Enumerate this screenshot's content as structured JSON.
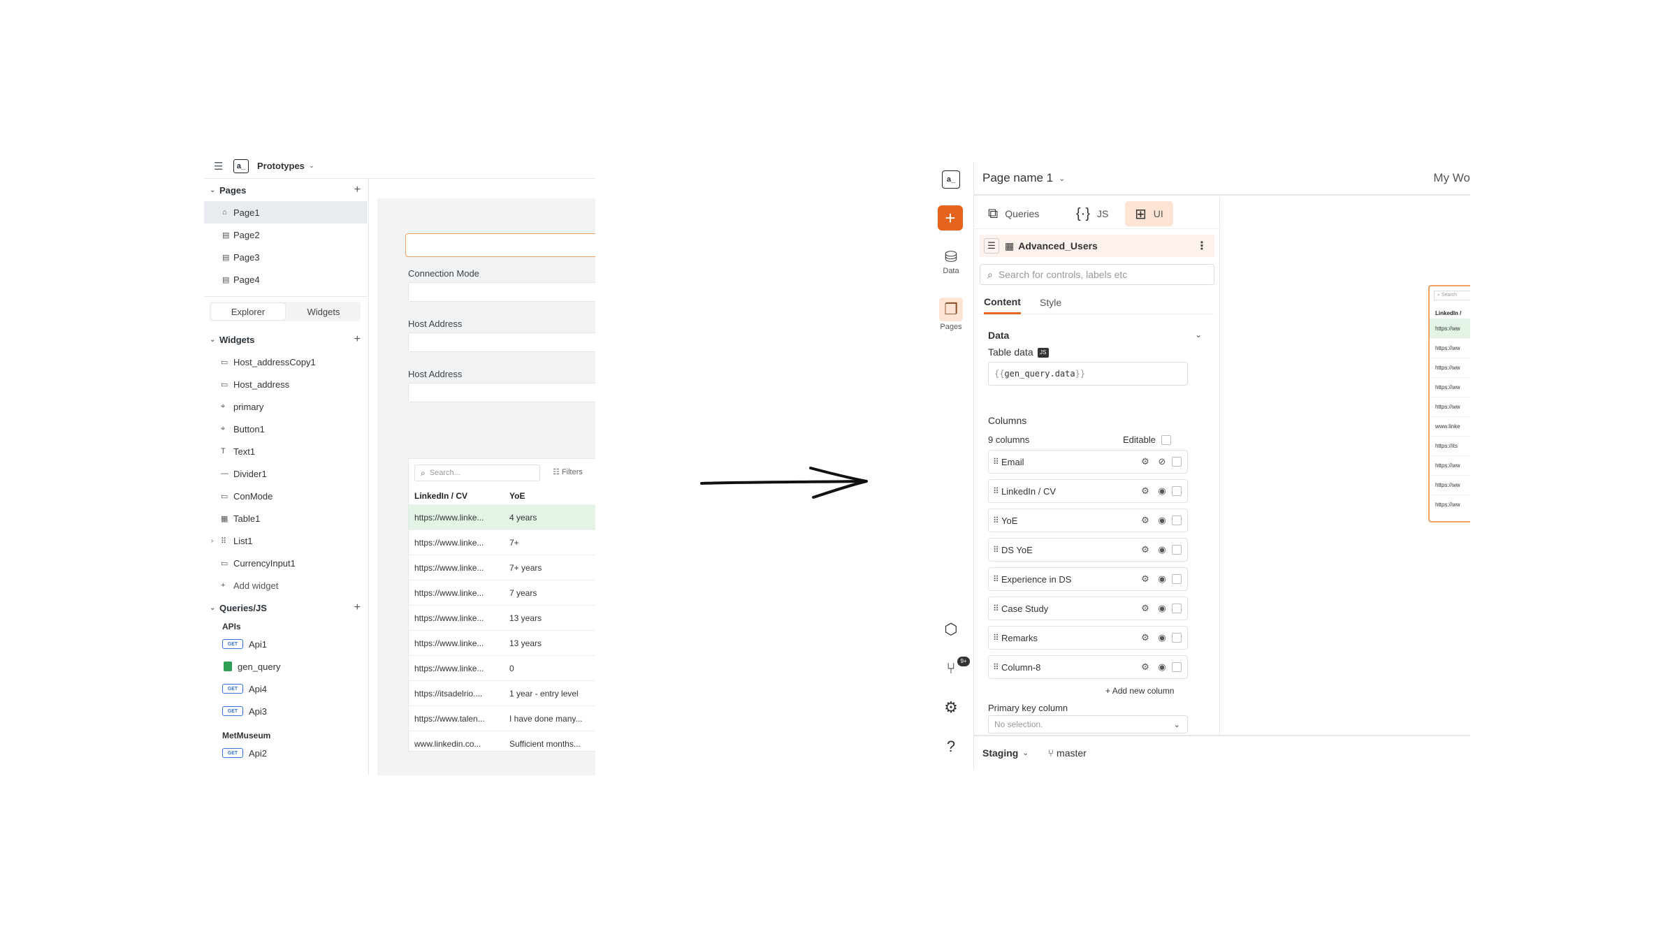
{
  "left": {
    "app_name": "Prototypes",
    "pages_title": "Pages",
    "pages": [
      "Page1",
      "Page2",
      "Page3",
      "Page4"
    ],
    "tabs": [
      "Explorer",
      "Widgets"
    ],
    "widgets_title": "Widgets",
    "widgets": [
      {
        "icon": "▭",
        "label": "Host_addressCopy1"
      },
      {
        "icon": "▭",
        "label": "Host_address"
      },
      {
        "icon": "⌖",
        "label": "primary"
      },
      {
        "icon": "⌖",
        "label": "Button1"
      },
      {
        "icon": "T",
        "label": "Text1"
      },
      {
        "icon": "—",
        "label": "Divider1"
      },
      {
        "icon": "▭",
        "label": "ConMode"
      },
      {
        "icon": "▦",
        "label": "Table1"
      },
      {
        "icon": "⠿",
        "label": "List1"
      },
      {
        "icon": "▭",
        "label": "CurrencyInput1"
      }
    ],
    "add_widget": "Add widget",
    "queries_title": "Queries/JS",
    "apis_group": "APIs",
    "queries": [
      {
        "type": "GET",
        "label": "Api1"
      },
      {
        "type": "sheet",
        "label": "gen_query"
      },
      {
        "type": "GET",
        "label": "Api4"
      },
      {
        "type": "GET",
        "label": "Api3"
      }
    ],
    "metmuseum_group": "MetMuseum",
    "met_query": {
      "type": "GET",
      "label": "Api2"
    },
    "canvas": {
      "labels": [
        "Connection Mode",
        "Host Address",
        "Host Address"
      ],
      "table": {
        "search_placeholder": "Search...",
        "filters_label": "Filters",
        "headers": [
          "LinkedIn / CV",
          "YoE"
        ],
        "rows": [
          [
            "https://www.linke...",
            "4 years"
          ],
          [
            "https://www.linke...",
            "7+"
          ],
          [
            "https://www.linke...",
            "7+ years"
          ],
          [
            "https://www.linke...",
            "7 years"
          ],
          [
            "https://www.linke...",
            "13 years"
          ],
          [
            "https://www.linke...",
            "13 years"
          ],
          [
            "https://www.linke...",
            "0"
          ],
          [
            "https://itsadelrio....",
            "1 year - entry level"
          ],
          [
            "https://www.talen...",
            "I have done many..."
          ],
          [
            "www.linkedin.co...",
            "Sufficient months..."
          ]
        ]
      }
    }
  },
  "right": {
    "page_name": "Page name 1",
    "workspace": "My Wo",
    "rail": {
      "data_label": "Data",
      "pages_label": "Pages",
      "badge": "9+"
    },
    "tabs": {
      "queries": "Queries",
      "js": "JS",
      "ui": "UI"
    },
    "widget_name": "Advanced_Users",
    "search_placeholder": "Search for controls, labels etc",
    "content_tabs": [
      "Content",
      "Style"
    ],
    "data_section": "Data",
    "table_data_label": "Table data",
    "js_badge": "JS",
    "table_data_open": "{{",
    "table_data_expr": "gen_query.data",
    "table_data_close": "}}",
    "columns_label": "Columns",
    "columns_count": "9 columns",
    "editable_label": "Editable",
    "columns": [
      "Email",
      "LinkedIn / CV",
      "YoE",
      "DS YoE",
      "Experience in DS",
      "Case Study",
      "Remarks",
      "Column-8"
    ],
    "add_column": "Add new column",
    "primary_key_label": "Primary key column",
    "primary_key_placeholder": "No selection.",
    "env": "Staging",
    "branch": "master",
    "mini_table": {
      "search": "Search",
      "header": "LinkedIn /",
      "rows": [
        "https://ww",
        "https://ww",
        "https://ww",
        "https://ww",
        "https://ww",
        "www.linke",
        "https://its",
        "https://ww",
        "https://ww",
        "https://ww"
      ]
    }
  }
}
